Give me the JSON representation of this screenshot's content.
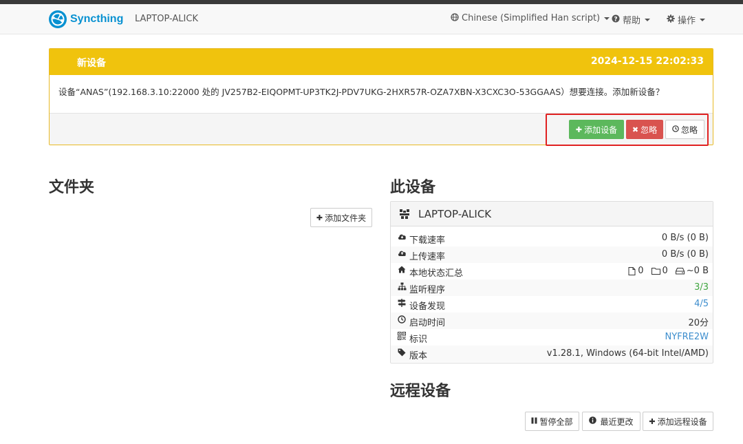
{
  "navbar": {
    "brand": "Syncthing",
    "device_name": "LAPTOP-ALICK",
    "language_label": "Chinese (Simplified Han script)",
    "help_label": "帮助",
    "actions_label": "操作"
  },
  "notice": {
    "title": "新设备",
    "timestamp": "2024-12-15 22:02:33",
    "message": "设备“ANAS”(192.168.3.10:22000 处的 JV257B2-EIQOPMT-UP3TK2J-PDV7UKG-2HXR57R-OZA7XBN-X3CXC3O-53GGAAS）想要连接。添加新设备？",
    "add_button": "添加设备",
    "ignore_button": "忽略",
    "dismiss_button": "忽略"
  },
  "folders": {
    "heading": "文件夹",
    "add_button": "添加文件夹"
  },
  "this_device": {
    "heading": "此设备",
    "name": "LAPTOP-ALICK",
    "rows": [
      {
        "label": "下载速率",
        "value": "0 B/s (0 B)",
        "icon": "cloud-download-icon"
      },
      {
        "label": "上传速率",
        "value": "0 B/s (0 B)",
        "icon": "cloud-upload-icon"
      },
      {
        "label": "本地状态汇总",
        "value": "",
        "icon": "home-icon"
      },
      {
        "label": "监听程序",
        "value": "3/3",
        "icon": "sitemap-icon"
      },
      {
        "label": "设备发现",
        "value": "4/5",
        "icon": "signpost-icon"
      },
      {
        "label": "启动时间",
        "value": "20分",
        "icon": "clock-icon"
      },
      {
        "label": "标识",
        "value": "NYFRE2W",
        "icon": "qrcode-icon"
      },
      {
        "label": "版本",
        "value": "v1.28.1, Windows (64-bit Intel/AMD)",
        "icon": "tag-icon"
      }
    ],
    "local_state": {
      "files": "0",
      "folders": "0",
      "size": "~0 B"
    }
  },
  "remote_devices": {
    "heading": "远程设备",
    "pause_all_button": "暂停全部",
    "recent_changes_button": "最近更改",
    "add_remote_button": "添加远程设备"
  },
  "colors": {
    "brand": "#0891d1",
    "notice": "#f0c30d",
    "success": "#5cb85c",
    "danger": "#d9534f",
    "highlight": "#e02020"
  }
}
